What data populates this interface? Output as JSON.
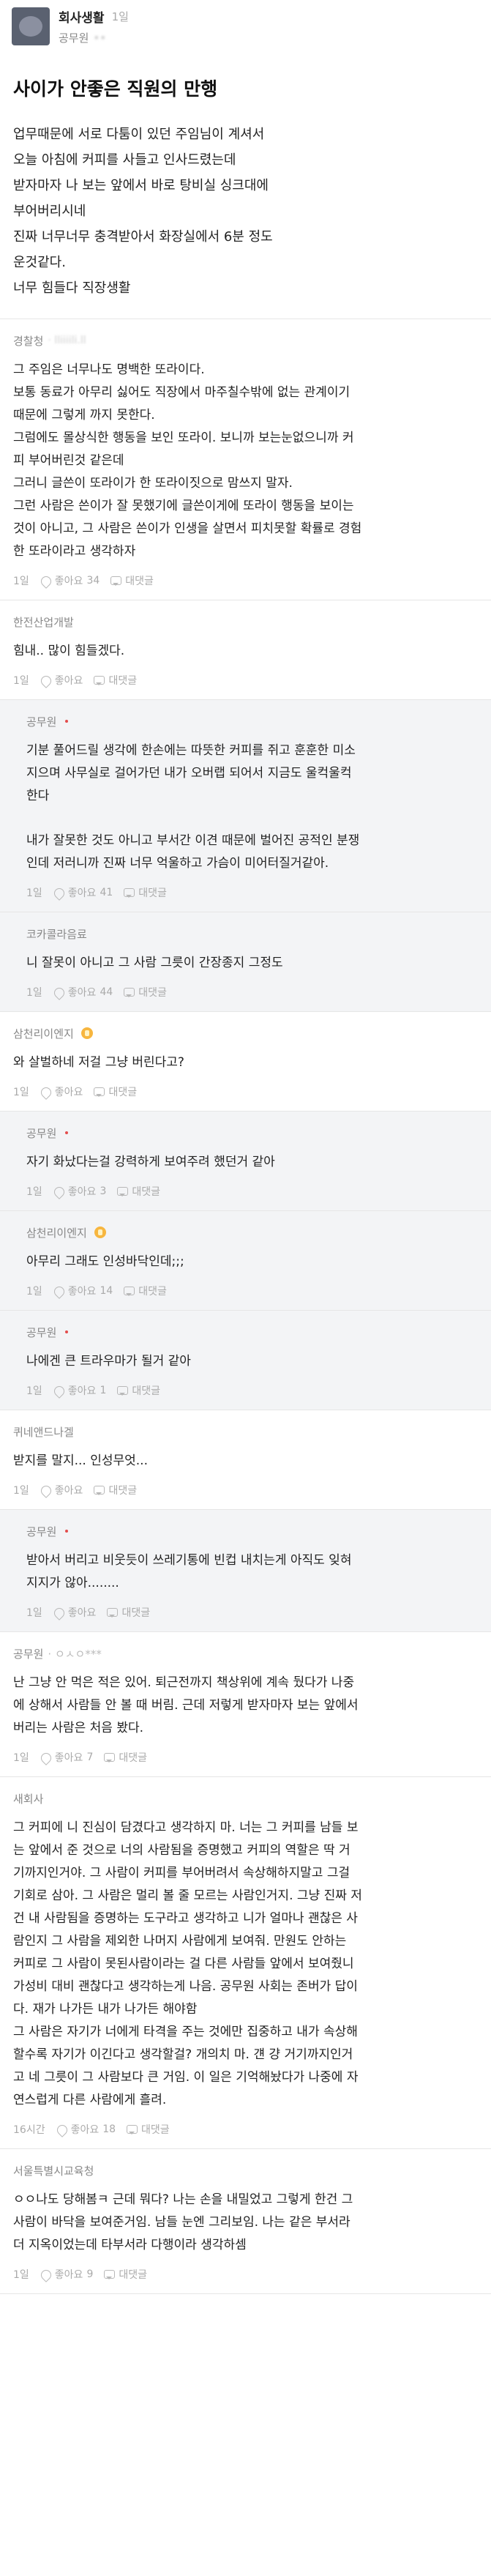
{
  "header": {
    "board_name": "회사생활",
    "time": "1일",
    "author": "공무원",
    "author_blur": "••"
  },
  "post": {
    "title": "사이가 안좋은 직원의 만행",
    "lines": [
      "업무때문에 서로 다툼이 있던 주임님이 계셔서",
      "오늘 아침에 커피를 사들고 인사드렸는데",
      "받자마자 나 보는 앞에서 바로 탕비실 싱크대에",
      "부어버리시네",
      "진짜 너무너무 충격받아서 화장실에서 6분 정도",
      "운것같다.",
      "너무 힘들다 직장생활"
    ]
  },
  "labels": {
    "like": "좋아요",
    "reply": "대댓글"
  },
  "comments": [
    {
      "author": "경찰청",
      "sub": "· lliiiili.ll",
      "reply": false,
      "paragraphs": [
        [
          "그 주임은 너무나도 명백한 또라이다.",
          "보통 동료가 아무리 싫어도 직장에서 마주칠수밖에 없는 관계이기",
          "때문에 그렇게 까지 못한다.",
          "그럼에도 몰상식한 행동을 보인 또라이. 보니까 보는눈없으니까 커",
          "피 부어버린것 같은데",
          "그러니 글쓴이 또라이가 한 또라이짓으로 맘쓰지 말자.",
          "그런 사람은 쓴이가 잘 못했기에 글쓴이게에 또라이 행동을 보이는",
          "것이 아니고, 그 사람은 쓴이가 인생을 살면서 피치못할 확률로 경험",
          "한 또라이라고 생각하자"
        ]
      ],
      "time": "1일",
      "likes": "34"
    },
    {
      "author": "한전산업개발",
      "sub": "",
      "reply": false,
      "paragraphs": [
        [
          "힘내.. 많이 힘들겠다."
        ]
      ],
      "time": "1일",
      "likes": ""
    },
    {
      "author": "공무원",
      "sub": "",
      "reply": true,
      "op": true,
      "paragraphs": [
        [
          "기분 풀어드릴 생각에 한손에는 따뜻한 커피를 쥐고 훈훈한 미소",
          "지으며 사무실로 걸어가던 내가 오버랩 되어서 지금도 울컥울컥",
          "한다"
        ],
        [
          "내가 잘못한 것도 아니고 부서간 이견 때문에 벌어진 공적인 분쟁",
          "인데 저러니까 진짜 너무 억울하고 가슴이 미어터질거같아."
        ]
      ],
      "time": "1일",
      "likes": "41"
    },
    {
      "author": "코카콜라음료",
      "sub": "",
      "reply": true,
      "paragraphs": [
        [
          "니 잘못이 아니고 그 사람 그릇이 간장종지 그정도"
        ]
      ],
      "time": "1일",
      "likes": "44"
    },
    {
      "author": "삼천리이엔지",
      "sub": "",
      "reply": false,
      "badge": true,
      "paragraphs": [
        [
          "와 살벌하네 저걸 그냥 버린다고?"
        ]
      ],
      "time": "1일",
      "likes": ""
    },
    {
      "author": "공무원",
      "sub": "",
      "reply": true,
      "op": true,
      "paragraphs": [
        [
          "자기 화났다는걸 강력하게 보여주려 했던거 같아"
        ]
      ],
      "time": "1일",
      "likes": "3"
    },
    {
      "author": "삼천리이엔지",
      "sub": "",
      "reply": true,
      "badge": true,
      "paragraphs": [
        [
          "아무리 그래도 인성바닥인데;;;"
        ]
      ],
      "time": "1일",
      "likes": "14"
    },
    {
      "author": "공무원",
      "sub": "",
      "reply": true,
      "op": true,
      "paragraphs": [
        [
          "나에겐 큰 트라우마가 될거 같아"
        ]
      ],
      "time": "1일",
      "likes": "1"
    },
    {
      "author": "퀴네앤드나겔",
      "sub": "",
      "reply": false,
      "paragraphs": [
        [
          "받지를 말지... 인성무엇..."
        ]
      ],
      "time": "1일",
      "likes": ""
    },
    {
      "author": "공무원",
      "sub": "",
      "reply": true,
      "op": true,
      "paragraphs": [
        [
          "받아서 버리고 비웃듯이 쓰레기통에 빈컵 내치는게 아직도 잊혀",
          "지지가 않아........"
        ]
      ],
      "time": "1일",
      "likes": ""
    },
    {
      "author": "공무원",
      "sub": "· ㅇㅅㅇ***",
      "reply": false,
      "paragraphs": [
        [
          "난 그냥 안 먹은 적은 있어. 퇴근전까지 책상위에 계속 뒀다가 나중",
          "에 상해서 사람들 안 볼 때 버림. 근데 저렇게 받자마자 보는 앞에서",
          "버리는 사람은 처음 봤다."
        ]
      ],
      "time": "1일",
      "likes": "7"
    },
    {
      "author": "새회사",
      "sub": "",
      "reply": false,
      "paragraphs": [
        [
          "그 커피에 니 진심이 담겼다고 생각하지 마. 너는 그 커피를 남들 보",
          "는 앞에서 준 것으로 너의 사람됨을 증명했고 커피의 역할은 딱 거",
          "기까지인거야. 그 사람이 커피를 부어버려서 속상해하지말고 그걸",
          "기회로 삼아. 그 사람은 멀리 볼 줄 모르는 사람인거지. 그냥 진짜 저",
          "건 내 사람됨을 증명하는 도구라고 생각하고 니가 얼마나 괜찮은 사",
          "람인지 그 사람을 제외한 나머지 사람에게 보여줘. 만원도 안하는",
          "커피로 그 사람이 못된사람이라는 걸 다른 사람들 앞에서 보여줬니",
          "가성비 대비 괜찮다고 생각하는게 나음. 공무원 사회는 존버가 답이",
          "다. 재가 나가든 내가 나가든 해야함",
          "그 사람은 자기가 너에게 타격을 주는 것에만 집중하고 내가 속상해",
          "할수록 자기가 이긴다고 생각할걸? 개의치 마. 걘 걍 거기까지인거",
          "고 네 그릇이 그 사람보다 큰 거임. 이 일은 기억해놨다가 나중에 자",
          "연스럽게 다른 사람에게 흘려."
        ]
      ],
      "time": "16시간",
      "likes": "18"
    },
    {
      "author": "서울특별시교육청",
      "sub": "",
      "reply": false,
      "paragraphs": [
        [
          "ㅇㅇ나도 당해봄ㅋ 근데 뭐다? 나는 손을 내밀었고 그렇게 한건 그",
          "사람이 바닥을 보여준거임. 남들 눈엔 그리보임. 나는 같은 부서라",
          "더 지옥이었는데 타부서라 다행이라 생각하셈"
        ]
      ],
      "time": "1일",
      "likes": "9"
    }
  ]
}
